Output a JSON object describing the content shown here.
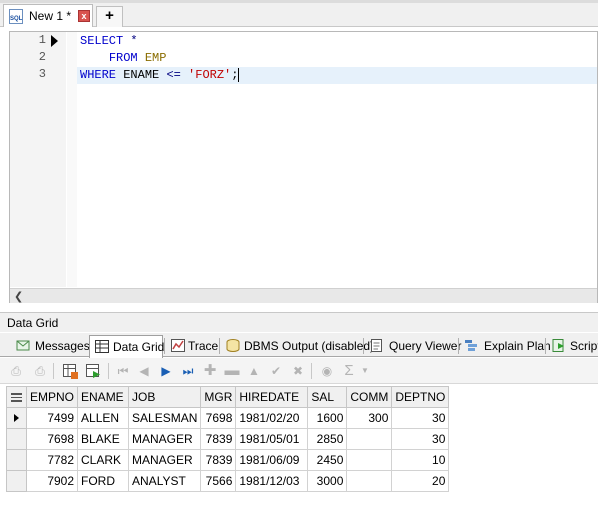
{
  "document_tab": {
    "title": "New 1 *",
    "close": "x",
    "new_tab": "+"
  },
  "editor": {
    "line_numbers": [
      "1",
      "2",
      "3"
    ],
    "lines": {
      "l1": {
        "kw1": "SELECT",
        "rest": " *"
      },
      "l2": {
        "indent": "    ",
        "kw": "FROM",
        "table": "EMP"
      },
      "l3": {
        "kw": "WHERE",
        "col": " ENAME ",
        "op": "<=",
        "str": "'FORZ'",
        "end": ";"
      }
    }
  },
  "panel": {
    "title": "Data Grid"
  },
  "result_tabs": [
    {
      "label": "Messages",
      "icon": "messages-icon"
    },
    {
      "label": "Data Grid",
      "icon": "data-grid-icon",
      "active": true
    },
    {
      "label": "Trace",
      "icon": "trace-icon"
    },
    {
      "label": "DBMS Output (disabled)",
      "icon": "dbms-output-icon"
    },
    {
      "label": "Query Viewer",
      "icon": "query-viewer-icon"
    },
    {
      "label": "Explain Plan",
      "icon": "explain-plan-icon"
    },
    {
      "label": "Script",
      "icon": "script-icon"
    }
  ],
  "toolbar": {
    "sum_symbol": "Σ"
  },
  "grid": {
    "columns": [
      "EMPNO",
      "ENAME",
      "JOB",
      "MGR",
      "HIREDATE",
      "SAL",
      "COMM",
      "DEPTNO"
    ],
    "rows": [
      [
        "7499",
        "ALLEN",
        "SALESMAN",
        "7698",
        "1981/02/20",
        "1600",
        "300",
        "30"
      ],
      [
        "7698",
        "BLAKE",
        "MANAGER",
        "7839",
        "1981/05/01",
        "2850",
        "",
        "30"
      ],
      [
        "7782",
        "CLARK",
        "MANAGER",
        "7839",
        "1981/06/09",
        "2450",
        "",
        "10"
      ],
      [
        "7902",
        "FORD",
        "ANALYST",
        "7566",
        "1981/12/03",
        "3000",
        "",
        "20"
      ]
    ],
    "current_row": 0
  },
  "colors": {
    "keyword": "#0000cc",
    "table": "#8a6d00",
    "string": "#c00000",
    "current_line": "#e6f1fb"
  }
}
